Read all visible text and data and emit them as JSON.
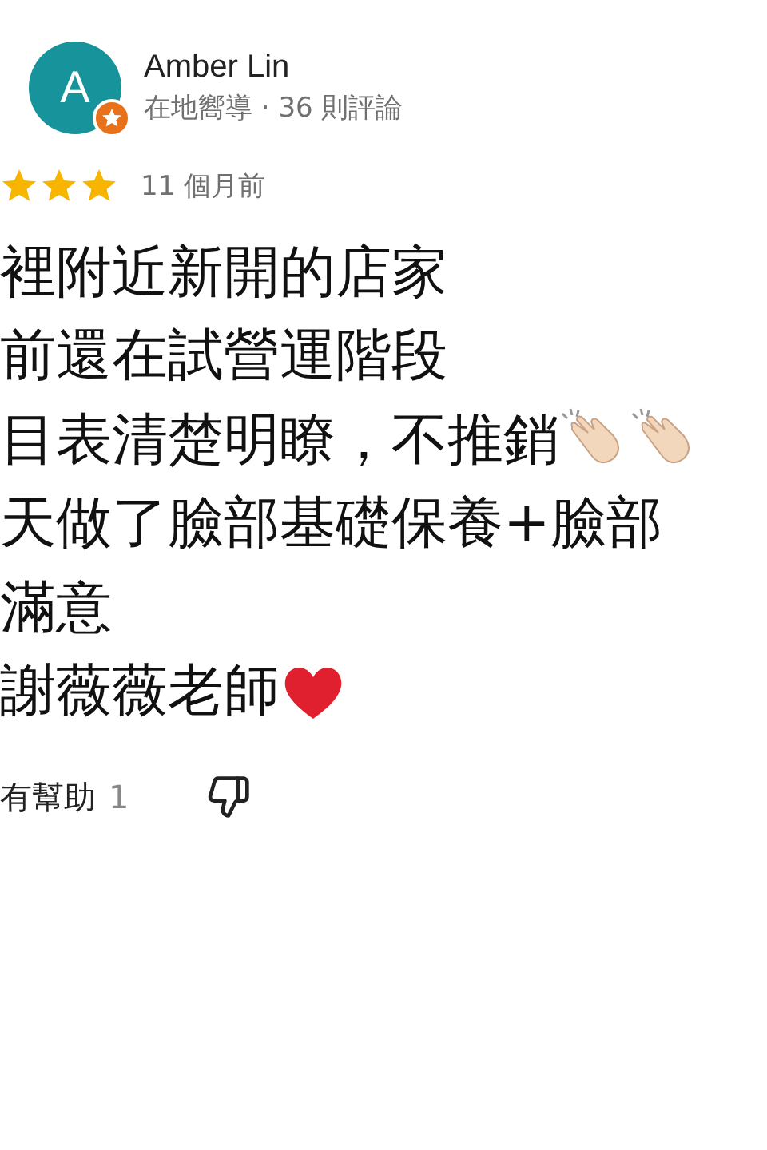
{
  "reviewer": {
    "avatar_letter": "A",
    "name": "Amber Lin",
    "subtitle": "在地嚮導 · 36 則評論"
  },
  "rating": {
    "stars": 3,
    "time": "11 個月前"
  },
  "review_lines": [
    {
      "text": "裡附近新開的店家",
      "kind": "plain"
    },
    {
      "text": "前還在試營運階段",
      "kind": "plain"
    },
    {
      "text": "目表清楚明瞭，不推銷",
      "kind": "clapping"
    },
    {
      "text": "天做了臉部基礎保養+臉部",
      "kind": "plain"
    },
    {
      "text": "滿意",
      "kind": "plain"
    },
    {
      "text": "謝薇薇老師",
      "kind": "heart"
    }
  ],
  "helpful": {
    "label": "有幫助",
    "count": "1"
  }
}
